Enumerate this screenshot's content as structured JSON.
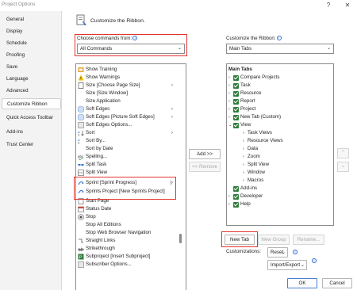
{
  "window": {
    "title": "Project Options",
    "help": "?",
    "close": "✕"
  },
  "sidebar": {
    "items": [
      {
        "label": "General"
      },
      {
        "label": "Display"
      },
      {
        "label": "Schedule"
      },
      {
        "label": "Proofing"
      },
      {
        "label": "Save"
      },
      {
        "label": "Language"
      },
      {
        "label": "Advanced"
      },
      {
        "label": "Customize Ribbon"
      },
      {
        "label": "Quick Access Toolbar"
      },
      {
        "label": "Add-ins"
      },
      {
        "label": "Trust Center"
      }
    ]
  },
  "header": {
    "title": "Customize the Ribbon."
  },
  "left": {
    "choose_label": "Choose commands from:",
    "choose_value": "All Commands",
    "items": [
      {
        "label": "Show Training"
      },
      {
        "label": "Show Warnings"
      },
      {
        "label": "Size [Choose Page Size]",
        "sub": "›"
      },
      {
        "label": "Size [Size Window]"
      },
      {
        "label": "Size Application"
      },
      {
        "label": "Soft Edges",
        "sub": "›"
      },
      {
        "label": "Soft Edges [Picture Soft Edges]",
        "sub": "›"
      },
      {
        "label": "Soft Edges Options..."
      },
      {
        "label": "Sort",
        "sub": "›"
      },
      {
        "label": "Sort By..."
      },
      {
        "label": "Sort by Date"
      },
      {
        "label": "Spelling..."
      },
      {
        "label": "Split Task"
      },
      {
        "label": "Split View"
      },
      {
        "label": "Sprint [Sprint Progress]",
        "sub": "|›"
      },
      {
        "label": "Sprints Project [New Sprints Project]"
      },
      {
        "label": "Start Page"
      },
      {
        "label": "Status Date"
      },
      {
        "label": "Stop"
      },
      {
        "label": "Stop All Editions"
      },
      {
        "label": "Stop Web Browser Navigation"
      },
      {
        "label": "Straight Links"
      },
      {
        "label": "Strikethrough"
      },
      {
        "label": "Subproject [Insert Subproject]"
      },
      {
        "label": "Subscriber Options..."
      }
    ]
  },
  "middle": {
    "add": "Add >>",
    "remove": "<< Remove"
  },
  "right": {
    "customize_label": "Customize the Ribbon:",
    "customize_value": "Main Tabs",
    "header": "Main Tabs",
    "items": [
      {
        "label": "Compare Projects",
        "level": 0
      },
      {
        "label": "Task",
        "level": 0
      },
      {
        "label": "Resource",
        "level": 0
      },
      {
        "label": "Report",
        "level": 0
      },
      {
        "label": "Project",
        "level": 0
      },
      {
        "label": "New Tab (Custom)",
        "level": 0
      },
      {
        "label": "View",
        "level": 0,
        "open": true
      },
      {
        "label": "Task Views",
        "level": 1
      },
      {
        "label": "Resource Views",
        "level": 1
      },
      {
        "label": "Data",
        "level": 1
      },
      {
        "label": "Zoom",
        "level": 1
      },
      {
        "label": "Split View",
        "level": 1
      },
      {
        "label": "Window",
        "level": 1
      },
      {
        "label": "Macros",
        "level": 1
      },
      {
        "label": "Add-ins",
        "level": 0,
        "nochev": true
      },
      {
        "label": "Developer",
        "level": 0
      },
      {
        "label": "Help",
        "level": 0
      }
    ],
    "new_tab": "New Tab",
    "new_group": "New Group",
    "rename": "Rename...",
    "customizations_label": "Customizations:",
    "reset": "Reset",
    "import_export": "Import/Export"
  },
  "footer": {
    "ok": "OK",
    "cancel": "Cancel"
  },
  "colors": {
    "accent": "#2b6cd1",
    "highlight": "#e3342f",
    "check": "#2f7d3b"
  }
}
